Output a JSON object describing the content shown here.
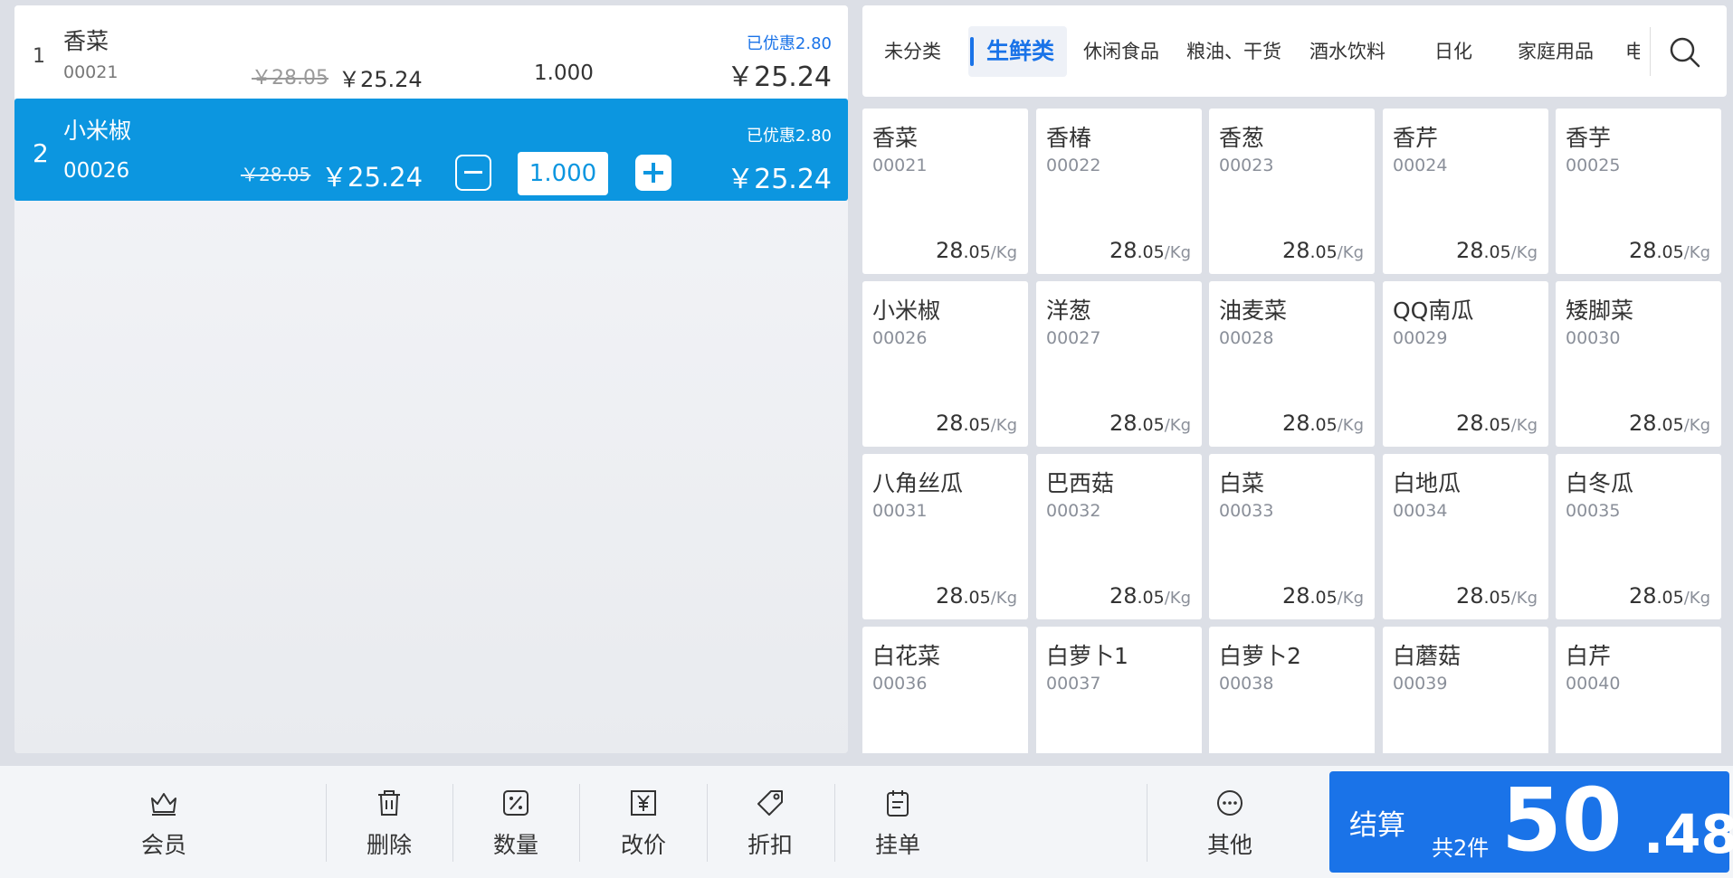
{
  "order": {
    "items": [
      {
        "index": "1",
        "name": "香菜",
        "code": "00021",
        "original_price": "￥28.05",
        "price": "￥25.24",
        "quantity": "1.000",
        "discount": "已优惠2.80",
        "total": "￥25.24",
        "selected": false
      },
      {
        "index": "2",
        "name": "小米椒",
        "code": "00026",
        "original_price": "￥28.05",
        "price": "￥25.24",
        "quantity": "1.000",
        "discount": "已优惠2.80",
        "total": "￥25.24",
        "selected": true
      }
    ],
    "minus_label": "−",
    "plus_label": "+"
  },
  "categories": {
    "tabs": [
      "未分类",
      "生鲜类",
      "休闲食品",
      "粮油、干货",
      "酒水饮料",
      "日化",
      "家庭用品",
      "电"
    ],
    "active_index": 1,
    "search_icon": "search-icon"
  },
  "products": [
    {
      "name": "香菜",
      "code": "00021",
      "price_int": "28",
      "price_dec": ".05",
      "unit": "/Kg"
    },
    {
      "name": "香椿",
      "code": "00022",
      "price_int": "28",
      "price_dec": ".05",
      "unit": "/Kg"
    },
    {
      "name": "香葱",
      "code": "00023",
      "price_int": "28",
      "price_dec": ".05",
      "unit": "/Kg"
    },
    {
      "name": "香芹",
      "code": "00024",
      "price_int": "28",
      "price_dec": ".05",
      "unit": "/Kg"
    },
    {
      "name": "香芋",
      "code": "00025",
      "price_int": "28",
      "price_dec": ".05",
      "unit": "/Kg"
    },
    {
      "name": "小米椒",
      "code": "00026",
      "price_int": "28",
      "price_dec": ".05",
      "unit": "/Kg"
    },
    {
      "name": "洋葱",
      "code": "00027",
      "price_int": "28",
      "price_dec": ".05",
      "unit": "/Kg"
    },
    {
      "name": "油麦菜",
      "code": "00028",
      "price_int": "28",
      "price_dec": ".05",
      "unit": "/Kg"
    },
    {
      "name": "QQ南瓜",
      "code": "00029",
      "price_int": "28",
      "price_dec": ".05",
      "unit": "/Kg"
    },
    {
      "name": "矮脚菜",
      "code": "00030",
      "price_int": "28",
      "price_dec": ".05",
      "unit": "/Kg"
    },
    {
      "name": "八角丝瓜",
      "code": "00031",
      "price_int": "28",
      "price_dec": ".05",
      "unit": "/Kg"
    },
    {
      "name": "巴西菇",
      "code": "00032",
      "price_int": "28",
      "price_dec": ".05",
      "unit": "/Kg"
    },
    {
      "name": "白菜",
      "code": "00033",
      "price_int": "28",
      "price_dec": ".05",
      "unit": "/Kg"
    },
    {
      "name": "白地瓜",
      "code": "00034",
      "price_int": "28",
      "price_dec": ".05",
      "unit": "/Kg"
    },
    {
      "name": "白冬瓜",
      "code": "00035",
      "price_int": "28",
      "price_dec": ".05",
      "unit": "/Kg"
    },
    {
      "name": "白花菜",
      "code": "00036",
      "price_int": "",
      "price_dec": "",
      "unit": ""
    },
    {
      "name": "白萝卜1",
      "code": "00037",
      "price_int": "",
      "price_dec": "",
      "unit": ""
    },
    {
      "name": "白萝卜2",
      "code": "00038",
      "price_int": "",
      "price_dec": "",
      "unit": ""
    },
    {
      "name": "白蘑菇",
      "code": "00039",
      "price_int": "",
      "price_dec": "",
      "unit": ""
    },
    {
      "name": "白芹",
      "code": "00040",
      "price_int": "",
      "price_dec": "",
      "unit": ""
    }
  ],
  "toolbar": {
    "member": "会员",
    "delete": "删除",
    "quantity": "数量",
    "change_price": "改价",
    "discount": "折扣",
    "hold_order": "挂单",
    "other": "其他"
  },
  "checkout": {
    "label": "结算",
    "count": "共2件",
    "total_int": "50",
    "total_dec": ".48"
  },
  "colors": {
    "accent": "#1a73e8",
    "selected_row": "#0c96e0"
  }
}
